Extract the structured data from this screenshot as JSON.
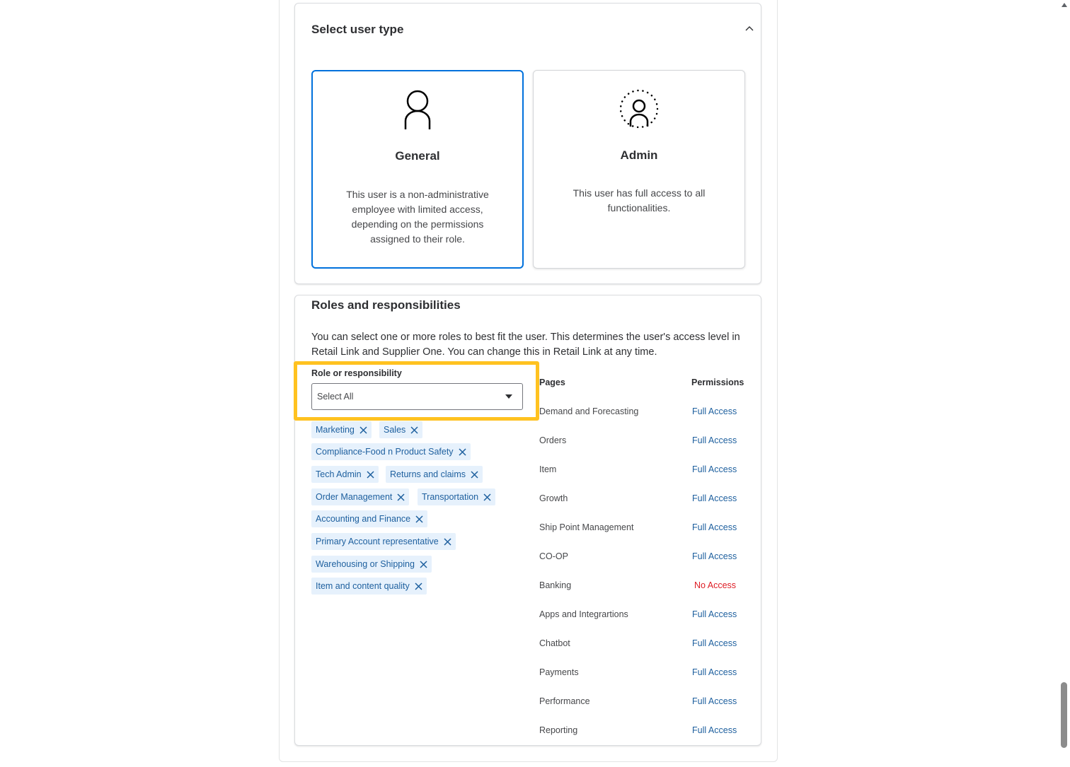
{
  "user_type": {
    "title": "Select user type",
    "options": [
      {
        "title": "General",
        "description": "This user is a non-administrative employee with limited access, depending on the permissions assigned to their role.",
        "selected": true,
        "icon": "person-icon"
      },
      {
        "title": "Admin",
        "description": "This user has full access to all functionalities.",
        "selected": false,
        "icon": "admin-person-icon"
      }
    ]
  },
  "roles": {
    "title": "Roles and responsibilities",
    "intro": "You can select one or more roles to best fit the user. This determines the user's access level in Retail Link and Supplier One. You can change this in Retail Link at any time.",
    "field_label": "Role or responsibility",
    "select_value": "Select All",
    "chips": [
      "Marketing",
      "Sales",
      "Compliance-Food n Product Safety",
      "Tech Admin",
      "Returns and claims",
      "Order Management",
      "Transportation",
      "Accounting and Finance",
      "Primary Account representative",
      "Warehousing or Shipping",
      "Item and content quality"
    ],
    "table": {
      "headers": [
        "Pages",
        "Permissions"
      ],
      "rows": [
        {
          "page": "Demand and Forecasting",
          "permission": "Full Access"
        },
        {
          "page": "Orders",
          "permission": "Full Access"
        },
        {
          "page": "Item",
          "permission": "Full Access"
        },
        {
          "page": "Growth",
          "permission": "Full Access"
        },
        {
          "page": "Ship Point Management",
          "permission": "Full Access"
        },
        {
          "page": "CO-OP",
          "permission": "Full Access"
        },
        {
          "page": "Banking",
          "permission": "No Access"
        },
        {
          "page": "Apps and Integrartions",
          "permission": "Full Access"
        },
        {
          "page": "Chatbot",
          "permission": "Full Access"
        },
        {
          "page": "Payments",
          "permission": "Full Access"
        },
        {
          "page": "Performance",
          "permission": "Full Access"
        },
        {
          "page": "Reporting",
          "permission": "Full Access"
        }
      ]
    }
  },
  "colors": {
    "accent": "#0071dc",
    "highlight": "#ffc220",
    "chip_bg": "#e6f1fc",
    "link": "#1d5f9e",
    "no_access": "#de1c24"
  }
}
